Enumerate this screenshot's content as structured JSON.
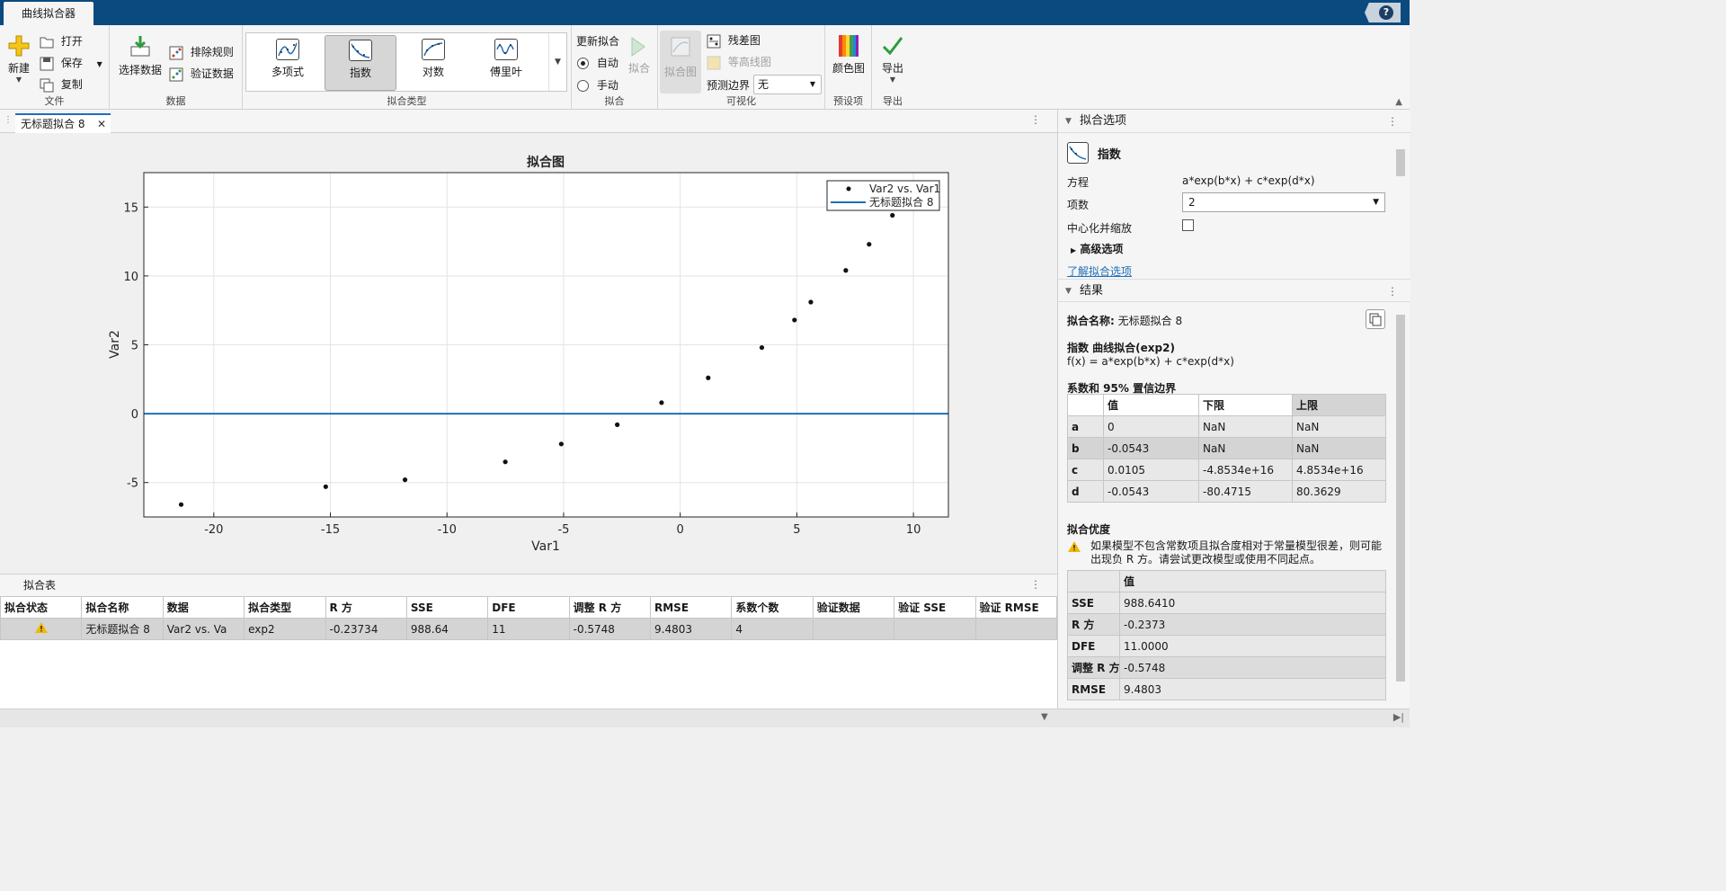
{
  "app": {
    "tab_title": "曲线拟合器",
    "help": "?"
  },
  "toolstrip": {
    "file": {
      "new": "新建",
      "open": "打开",
      "save": "保存",
      "copy": "复制",
      "label": "文件"
    },
    "data": {
      "select": "选择数据",
      "exclude": "排除规则",
      "validate": "验证数据",
      "label": "数据"
    },
    "fit_type": {
      "label": "拟合类型",
      "items": [
        {
          "label": "多项式"
        },
        {
          "label": "指数"
        },
        {
          "label": "对数"
        },
        {
          "label": "傅里叶"
        }
      ]
    },
    "fit": {
      "update": "更新拟合",
      "auto": "自动",
      "manual": "手动",
      "fit_button": "拟合",
      "label": "拟合"
    },
    "visualize": {
      "fit_plot": "拟合图",
      "residuals": "残差图",
      "contour": "等高线图",
      "bounds_label": "预测边界",
      "bounds_value": "无",
      "label": "可视化"
    },
    "presets": {
      "colormap": "颜色图",
      "label": "预设项"
    },
    "export": {
      "export": "导出",
      "label": "导出"
    }
  },
  "document": {
    "tab_label": "无标题拟合 8"
  },
  "chart_data": {
    "type": "scatter",
    "title": "拟合图",
    "xlabel": "Var1",
    "ylabel": "Var2",
    "xlim": [
      -23.0,
      11.5
    ],
    "ylim": [
      -7.5,
      17.5
    ],
    "xticks": [
      -20,
      -15,
      -10,
      -5,
      0,
      5,
      10
    ],
    "yticks": [
      -5,
      0,
      5,
      10,
      15
    ],
    "grid": true,
    "legend_position": "top-right",
    "series": [
      {
        "name": "Var2 vs. Var1",
        "kind": "points",
        "x": [
          -21.4,
          -15.2,
          -11.8,
          -7.5,
          -5.1,
          -2.7,
          -0.8,
          1.2,
          3.5,
          4.9,
          5.6,
          7.1,
          8.1,
          9.1
        ],
        "y": [
          -6.6,
          -5.3,
          -4.8,
          -3.5,
          -2.2,
          -0.8,
          0.8,
          2.6,
          4.8,
          6.8,
          8.1,
          10.4,
          12.3,
          14.4
        ]
      },
      {
        "name": "无标题拟合 8",
        "kind": "line",
        "x": [
          -23.0,
          11.5
        ],
        "y": [
          0.0,
          0.0
        ],
        "color": "#1f6fb8"
      }
    ]
  },
  "fit_table": {
    "title": "拟合表",
    "columns": [
      "拟合状态",
      "拟合名称",
      "数据",
      "拟合类型",
      "R 方",
      "SSE",
      "DFE",
      "调整 R 方",
      "RMSE",
      "系数个数",
      "验证数据",
      "验证 SSE",
      "验证 RMSE"
    ],
    "rows": [
      [
        "",
        "无标题拟合 8",
        "Var2 vs. Va",
        "exp2",
        "-0.23734",
        "988.64",
        "11",
        "-0.5748",
        "9.4803",
        "4",
        "",
        "",
        ""
      ]
    ]
  },
  "fit_options": {
    "header": "拟合选项",
    "type": "指数",
    "equation_label": "方程",
    "equation": "a*exp(b*x) + c*exp(d*x)",
    "terms_label": "项数",
    "terms_value": "2",
    "center_label": "中心化并缩放",
    "advanced": "高级选项",
    "learn_more": "了解拟合选项"
  },
  "results": {
    "header": "结果",
    "fit_name_label": "拟合名称:",
    "fit_name": "无标题拟合 8",
    "model_title": "指数 曲线拟合(exp2)",
    "model_formula": "f(x) = a*exp(b*x) + c*exp(d*x)",
    "coef_title": "系数和 95% 置信边界",
    "coef_columns": [
      "",
      "值",
      "下限",
      "上限"
    ],
    "coefs": [
      [
        "a",
        "0",
        "NaN",
        "NaN"
      ],
      [
        "b",
        "-0.0543",
        "NaN",
        "NaN"
      ],
      [
        "c",
        "0.0105",
        "-4.8534e+16",
        "4.8534e+16"
      ],
      [
        "d",
        "-0.0543",
        "-80.4715",
        "80.3629"
      ]
    ],
    "gof_title": "拟合优度",
    "warning": "如果模型不包含常数项且拟合度相对于常量模型很差，则可能出现负 R 方。请尝试更改模型或使用不同起点。",
    "gof_columns": [
      "",
      "值"
    ],
    "gof": [
      [
        "SSE",
        "988.6410"
      ],
      [
        "R 方",
        "-0.2373"
      ],
      [
        "DFE",
        "11.0000"
      ],
      [
        "调整 R 方",
        "-0.5748"
      ],
      [
        "RMSE",
        "9.4803"
      ]
    ]
  }
}
